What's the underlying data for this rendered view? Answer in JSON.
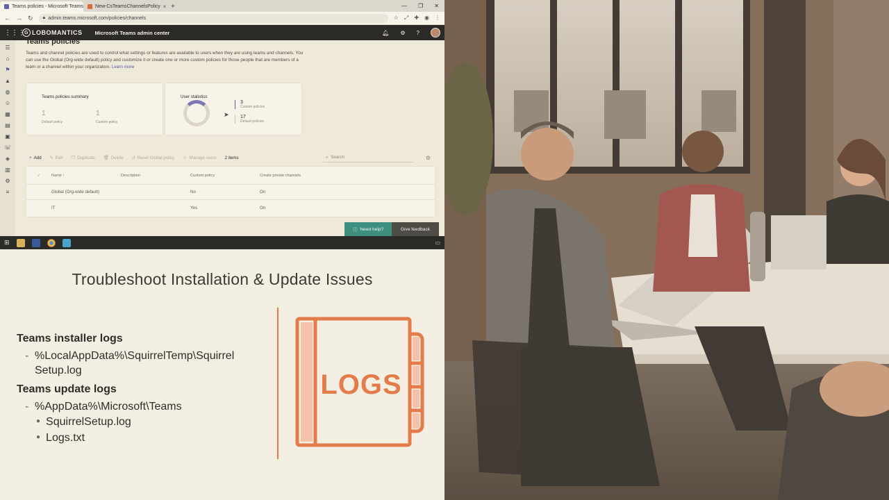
{
  "browser": {
    "tabs": [
      {
        "label": "Teams policies - Microsoft Teams",
        "color": "#6264a7"
      },
      {
        "label": "New-CsTeamsChannelsPolicy",
        "color": "#e06b3d"
      }
    ],
    "new_tab": "+",
    "url": "admin.teams.microsoft.com/policies/channels"
  },
  "suite": {
    "logo_letter": "G",
    "logo_text": "LOBOMANTICS",
    "title": "Microsoft Teams admin center"
  },
  "page": {
    "title": "Teams policies",
    "description": "Teams and channel policies are used to control what settings or features are available to users when they are using teams and channels. You can use the Global (Org-wide default) policy and customize it or create one or more custom policies for those people that are members of a team or a channel within your organization.",
    "learn_more": "Learn more"
  },
  "summary_card": {
    "title": "Teams policies summary",
    "default_count": "1",
    "default_label": "Default policy",
    "custom_count": "1",
    "custom_label": "Custom policy"
  },
  "user_stats_card": {
    "title": "User statistics",
    "custom_count": "3",
    "custom_label": "Custom policies",
    "default_count": "17",
    "default_label": "Default policies"
  },
  "toolbar": {
    "add": "Add",
    "edit": "Edit",
    "duplicate": "Duplicate",
    "delete": "Delete",
    "reset": "Reset Global policy",
    "manage": "Manage users",
    "items": "2 items",
    "search_placeholder": "Search"
  },
  "table": {
    "headers": {
      "name": "Name ↑",
      "description": "Description",
      "custom": "Custom policy",
      "private": "Create private channels"
    },
    "rows": [
      {
        "name": "Global (Org-wide default)",
        "description": "",
        "custom": "No",
        "private": "On"
      },
      {
        "name": "IT",
        "description": "",
        "custom": "Yes",
        "private": "On"
      }
    ]
  },
  "help": {
    "need_help": "Need help?",
    "feedback": "Give feedback"
  },
  "slide": {
    "title": "Troubleshoot Installation & Update Issues",
    "installer_heading": "Teams installer logs",
    "installer_path": "%LocalAppData%\\SquirrelTemp\\Squirrel Setup.log",
    "update_heading": "Teams update logs",
    "update_path": "%AppData%\\Microsoft\\Teams",
    "update_files": [
      "SquirrelSetup.log",
      "Logs.txt"
    ],
    "logs_badge": "LOGS",
    "accent_color": "#e37b4a"
  }
}
